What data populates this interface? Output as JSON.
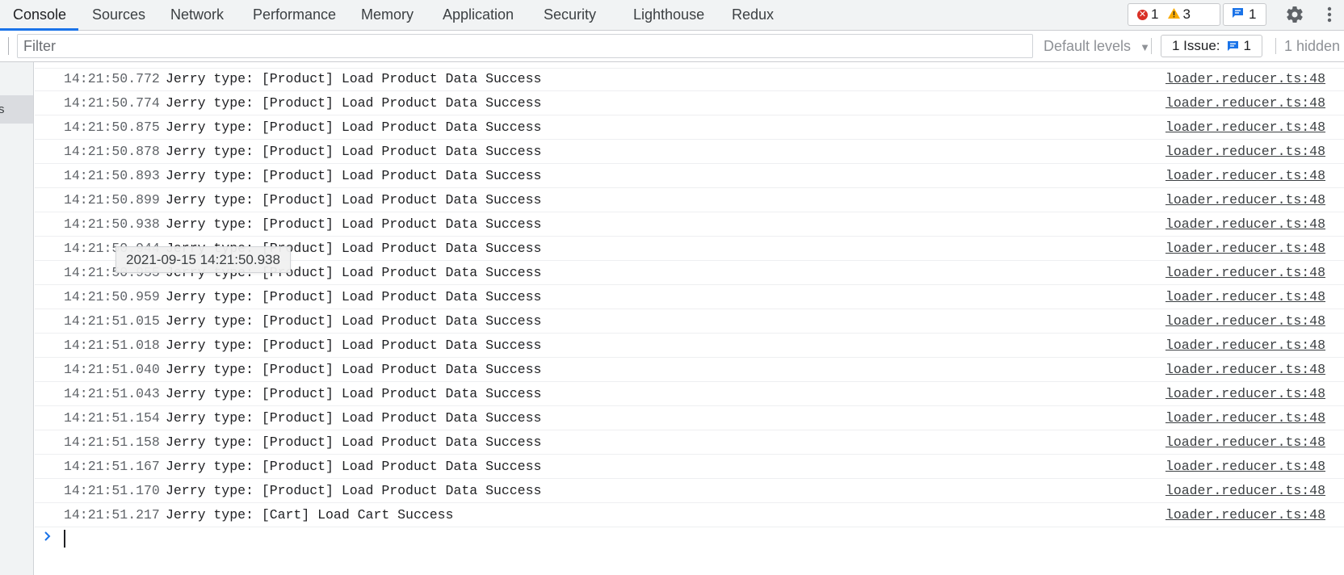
{
  "tabs": [
    {
      "label": "Console",
      "active": true
    },
    {
      "label": "Sources"
    },
    {
      "label": "Network"
    },
    {
      "label": "Performance"
    },
    {
      "label": "Memory"
    },
    {
      "label": "Application"
    },
    {
      "label": "Security"
    },
    {
      "label": "Lighthouse"
    },
    {
      "label": "Redux"
    }
  ],
  "counters": {
    "errors": "1",
    "warnings": "3",
    "messages": "1",
    "error_icon": "error-circle-icon",
    "warning_icon": "warning-triangle-icon",
    "message_icon": "message-icon"
  },
  "toolbar_icons": {
    "settings": "gear-icon",
    "more": "kebab-menu-icon"
  },
  "filter": {
    "placeholder": "Filter",
    "value": "",
    "levels_label": "Default levels",
    "levels_icon": "dropdown-triangle-icon",
    "issues_label": "1 Issue:",
    "issues_count": "1",
    "hidden_label": "1 hidden"
  },
  "sidebar": {
    "selected_fragment": "s"
  },
  "log": {
    "rows": [
      {
        "ts": "14:21:50.772",
        "msg": "Jerry type: [Product] Load Product Data Success",
        "src": "loader.reducer.ts:48"
      },
      {
        "ts": "14:21:50.774",
        "msg": "Jerry type: [Product] Load Product Data Success",
        "src": "loader.reducer.ts:48"
      },
      {
        "ts": "14:21:50.875",
        "msg": "Jerry type: [Product] Load Product Data Success",
        "src": "loader.reducer.ts:48"
      },
      {
        "ts": "14:21:50.878",
        "msg": "Jerry type: [Product] Load Product Data Success",
        "src": "loader.reducer.ts:48"
      },
      {
        "ts": "14:21:50.893",
        "msg": "Jerry type: [Product] Load Product Data Success",
        "src": "loader.reducer.ts:48"
      },
      {
        "ts": "14:21:50.899",
        "msg": "Jerry type: [Product] Load Product Data Success",
        "src": "loader.reducer.ts:48"
      },
      {
        "ts": "14:21:50.938",
        "msg": "Jerry type: [Product] Load Product Data Success",
        "src": "loader.reducer.ts:48"
      },
      {
        "ts": "14:21:50.944",
        "msg": "Jerry type: [Product] Load Product Data Success",
        "src": "loader.reducer.ts:48"
      },
      {
        "ts": "14:21:50.955",
        "msg": "Jerry type: [Product] Load Product Data Success",
        "src": "loader.reducer.ts:48"
      },
      {
        "ts": "14:21:50.959",
        "msg": "Jerry type: [Product] Load Product Data Success",
        "src": "loader.reducer.ts:48"
      },
      {
        "ts": "14:21:51.015",
        "msg": "Jerry type: [Product] Load Product Data Success",
        "src": "loader.reducer.ts:48"
      },
      {
        "ts": "14:21:51.018",
        "msg": "Jerry type: [Product] Load Product Data Success",
        "src": "loader.reducer.ts:48"
      },
      {
        "ts": "14:21:51.040",
        "msg": "Jerry type: [Product] Load Product Data Success",
        "src": "loader.reducer.ts:48"
      },
      {
        "ts": "14:21:51.043",
        "msg": "Jerry type: [Product] Load Product Data Success",
        "src": "loader.reducer.ts:48"
      },
      {
        "ts": "14:21:51.154",
        "msg": "Jerry type: [Product] Load Product Data Success",
        "src": "loader.reducer.ts:48"
      },
      {
        "ts": "14:21:51.158",
        "msg": "Jerry type: [Product] Load Product Data Success",
        "src": "loader.reducer.ts:48"
      },
      {
        "ts": "14:21:51.167",
        "msg": "Jerry type: [Product] Load Product Data Success",
        "src": "loader.reducer.ts:48"
      },
      {
        "ts": "14:21:51.170",
        "msg": "Jerry type: [Product] Load Product Data Success",
        "src": "loader.reducer.ts:48"
      },
      {
        "ts": "14:21:51.217",
        "msg": "Jerry type: [Cart] Load Cart Success",
        "src": "loader.reducer.ts:48"
      }
    ],
    "prompt_icon": "chevron-right-icon"
  },
  "tooltip": {
    "text": "2021-09-15 14:21:50.938"
  },
  "colors": {
    "accent": "#1a73e8",
    "error": "#d93025",
    "warning": "#f9ab00"
  }
}
